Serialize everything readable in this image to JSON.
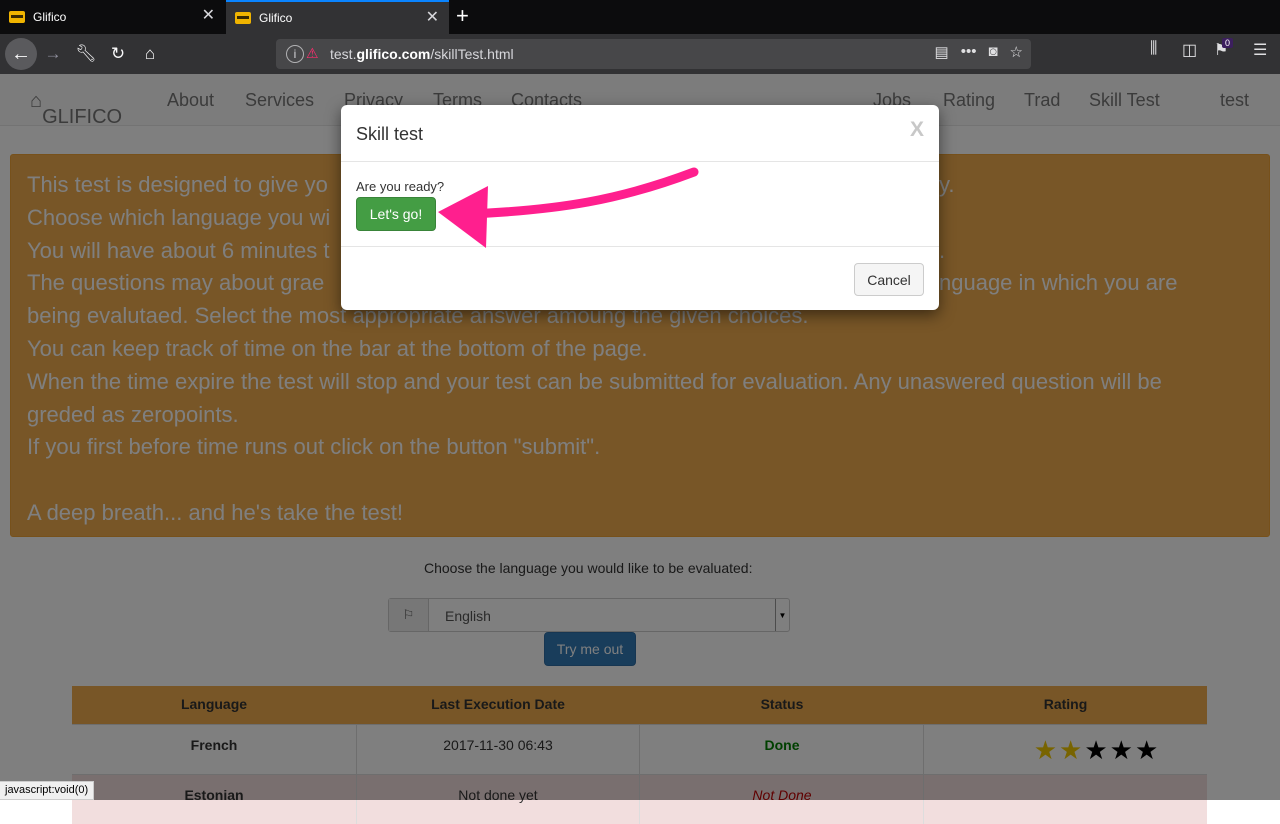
{
  "browser": {
    "tabs": [
      {
        "title": "Glifico"
      },
      {
        "title": "Glifico"
      }
    ],
    "url_prefix": "test.",
    "url_domain": "glifico.com",
    "url_path": "/skillTest.html",
    "notification_count": "0",
    "status_text": "javascript:void(0)"
  },
  "site_nav": {
    "brand": "GLIFICO",
    "left_items": [
      "About",
      "Services",
      "Privacy",
      "Terms",
      "Contacts"
    ],
    "right_items": [
      "Jobs",
      "Rating",
      "Trad",
      "Skill Test",
      "test"
    ]
  },
  "info": {
    "lines": [
      "This test is designed to give yo",
      "Choose which language you wi",
      "You will have about 6 minutes t",
      "The questions may about grae",
      "being evalutaed. Select the most appropriate answer amoung the given choices.",
      "You can keep track of time on the bar at the bottom of the page.",
      "When the time expire the test will stop and your test can be submitted for evaluation. Any unaswered question will be",
      "greded as zeropoints.",
      "If you first before time runs out click on the button \"submit\".",
      "",
      "A deep breath... and he's take the test!"
    ],
    "line1_tail": "y.",
    "line3_tail": ".",
    "line4_tail": "nguage in which you are"
  },
  "language_select": {
    "prompt": "Choose the language you would like to be evaluated:",
    "value": "English",
    "try_label": "Try me out"
  },
  "table": {
    "headers": [
      "Language",
      "Last Execution Date",
      "Status",
      "Rating"
    ],
    "rows": [
      {
        "language": "French",
        "date": "2017-11-30 06:43",
        "status": "Done",
        "rating": 2,
        "max_rating": 5
      },
      {
        "language": "Estonian",
        "date": "Not done yet",
        "status": "Not Done",
        "rating": null
      }
    ],
    "status_colors": {
      "done": "#008000",
      "not_done": "#c00000"
    }
  },
  "modal": {
    "title": "Skill test",
    "close": "X",
    "question": "Are you ready?",
    "go_label": "Let's go!",
    "cancel_label": "Cancel"
  },
  "colors": {
    "annotation_arrow": "#ff1f8e",
    "accent": "#f0ad4e"
  }
}
